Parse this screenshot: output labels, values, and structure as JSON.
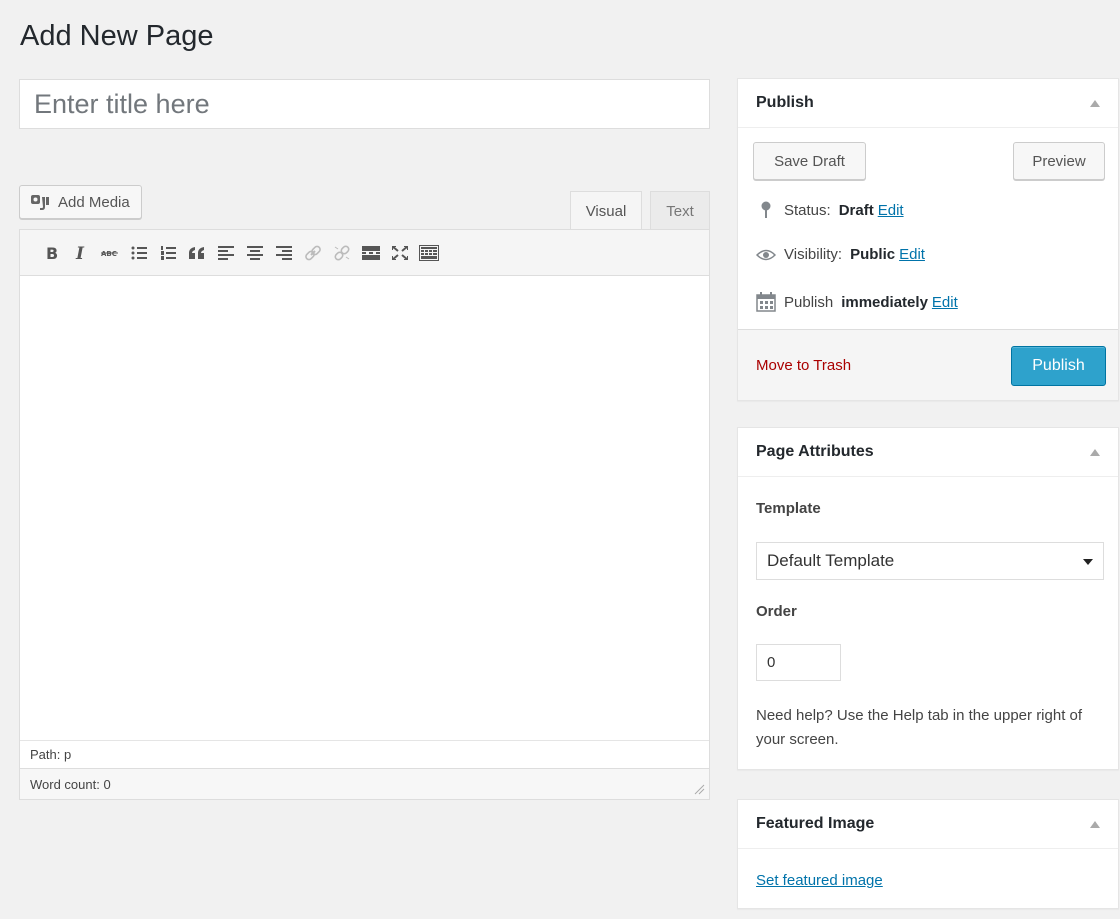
{
  "page": {
    "title": "Add New Page"
  },
  "title_field": {
    "placeholder": "Enter title here",
    "value": ""
  },
  "media": {
    "add_label": "Add Media"
  },
  "editor_tabs": [
    {
      "label": "Visual",
      "active": true
    },
    {
      "label": "Text",
      "active": false
    }
  ],
  "toolbar": {
    "buttons": [
      "bold",
      "italic",
      "strikethrough",
      "bulleted-list",
      "numbered-list",
      "blockquote",
      "align-left",
      "align-center",
      "align-right",
      "insert-link",
      "remove-link",
      "read-more",
      "fullscreen",
      "toolbar-toggle"
    ]
  },
  "editor": {
    "path_label": "Path: p",
    "word_count_label": "Word count: 0"
  },
  "publish": {
    "title": "Publish",
    "save_draft": "Save Draft",
    "preview": "Preview",
    "status_label": "Status:",
    "status_value": "Draft",
    "visibility_label": "Visibility:",
    "visibility_value": "Public",
    "publish_label": "Publish",
    "publish_value": "immediately",
    "edit_link": "Edit",
    "move_to_trash": "Move to Trash",
    "publish_button": "Publish",
    "publish_button_color": "#2ea2cc"
  },
  "page_attributes": {
    "title": "Page Attributes",
    "template_label": "Template",
    "template_selected": "Default Template",
    "order_label": "Order",
    "order_value": "0",
    "help_text": "Need help? Use the Help tab in the upper right of your screen."
  },
  "featured_image": {
    "title": "Featured Image",
    "set_link": "Set featured image"
  },
  "colors": {
    "link": "#0073aa",
    "trash": "#aa0000"
  }
}
